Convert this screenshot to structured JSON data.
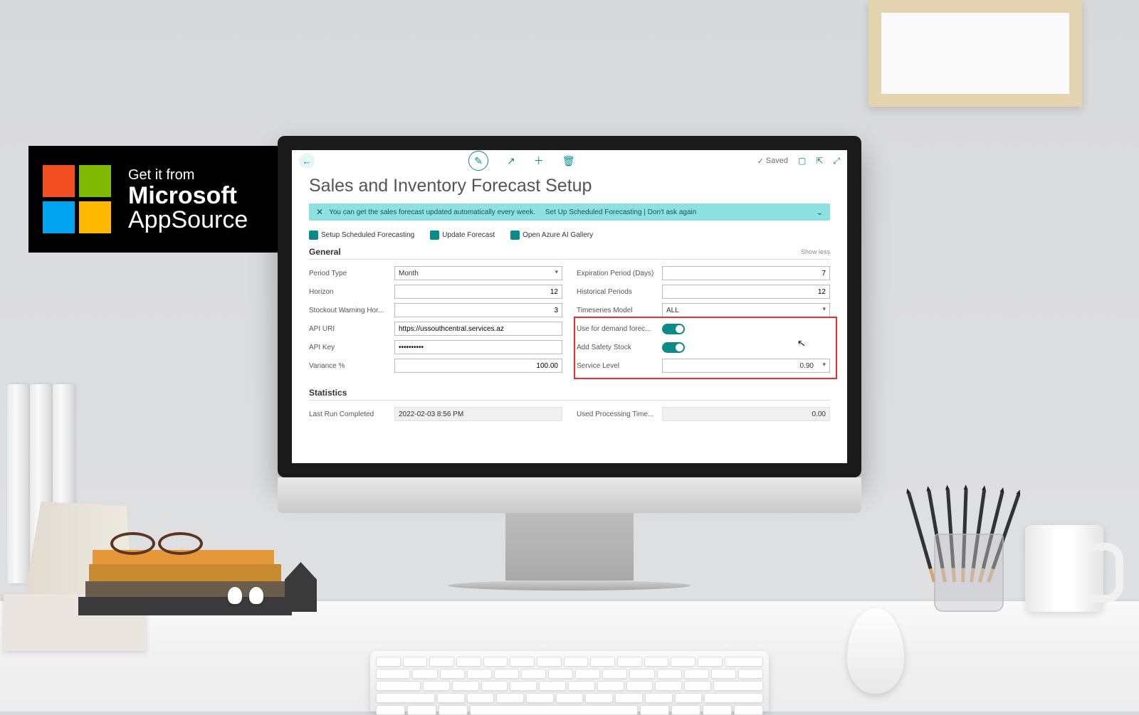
{
  "appsource": {
    "line1": "Get it from",
    "line2": "Microsoft",
    "line3": "AppSource"
  },
  "topbar": {
    "saved_label": "Saved"
  },
  "page": {
    "title": "Sales and Inventory Forecast Setup"
  },
  "notification": {
    "message": "You can get the sales forecast updated automatically every week.",
    "action": "Set Up Scheduled Forecasting | Don't ask again"
  },
  "actions": {
    "setup_scheduled": "Setup Scheduled Forecasting",
    "update_forecast": "Update Forecast",
    "open_azure_gallery": "Open Azure AI Gallery"
  },
  "sections": {
    "general": {
      "title": "General",
      "show_less": "Show less"
    },
    "statistics": {
      "title": "Statistics"
    }
  },
  "fields": {
    "period_type": {
      "label": "Period Type",
      "value": "Month"
    },
    "horizon": {
      "label": "Horizon",
      "value": "12"
    },
    "stockout_warning": {
      "label": "Stockout Warning Hor...",
      "value": "3"
    },
    "api_uri": {
      "label": "API URI",
      "value": "https://ussouthcentral.services.az"
    },
    "api_key": {
      "label": "API Key",
      "value": "••••••••••"
    },
    "variance": {
      "label": "Variance %",
      "value": "100.00"
    },
    "expiration_period": {
      "label": "Expiration Period (Days)",
      "value": "7"
    },
    "historical_periods": {
      "label": "Historical Periods",
      "value": "12"
    },
    "timeseries_model": {
      "label": "Timeseries Model",
      "value": "ALL"
    },
    "use_demand_forecast": {
      "label": "Use for demand forec...",
      "value": "true"
    },
    "add_safety_stock": {
      "label": "Add Safety Stock",
      "value": "true"
    },
    "service_level": {
      "label": "Service Level",
      "value": "0.90"
    },
    "last_run": {
      "label": "Last Run Completed",
      "value": "2022-02-03 8:56 PM"
    },
    "used_processing": {
      "label": "Used Processing Time...",
      "value": "0.00"
    }
  },
  "colors": {
    "accent": "#0b8a8a",
    "notification_bg": "#8fe0e0",
    "highlight": "#f22b2b"
  }
}
